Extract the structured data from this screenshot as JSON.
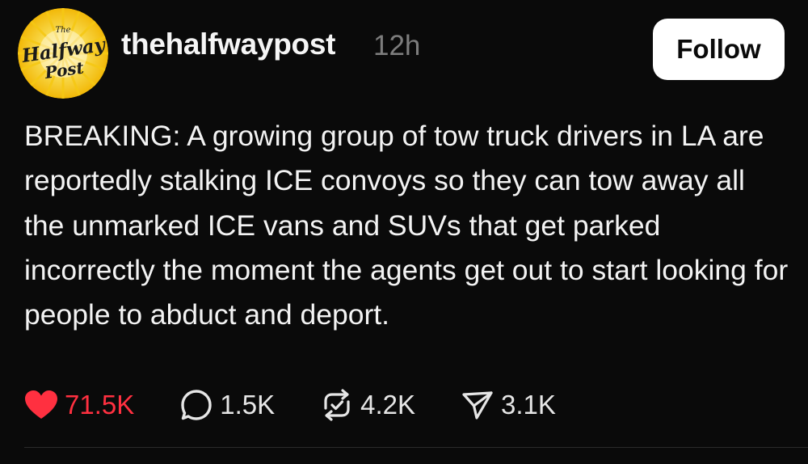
{
  "post": {
    "avatar": {
      "logo_text_small": "The",
      "logo_text_main": "Halfway",
      "logo_text_sub": "Post",
      "logo_colors": [
        "#f6c814",
        "#fff3b0",
        "#1a1a1a"
      ]
    },
    "username": "thehalfwaypost",
    "timestamp": "12h",
    "follow_label": "Follow",
    "text": "BREAKING: A growing group of tow truck drivers in LA are reportedly stalking ICE convoys so they can tow away all the unmarked ICE vans and SUVs that get parked incorrectly the moment the agents get out to start looking for people to abduct and deport.",
    "actions": {
      "likes": {
        "icon": "heart-icon",
        "count": "71.5K",
        "color": "#ff3040"
      },
      "replies": {
        "icon": "comment-icon",
        "count": "1.5K"
      },
      "reposts": {
        "icon": "repost-icon",
        "count": "4.2K"
      },
      "shares": {
        "icon": "share-icon",
        "count": "3.1K"
      }
    }
  }
}
